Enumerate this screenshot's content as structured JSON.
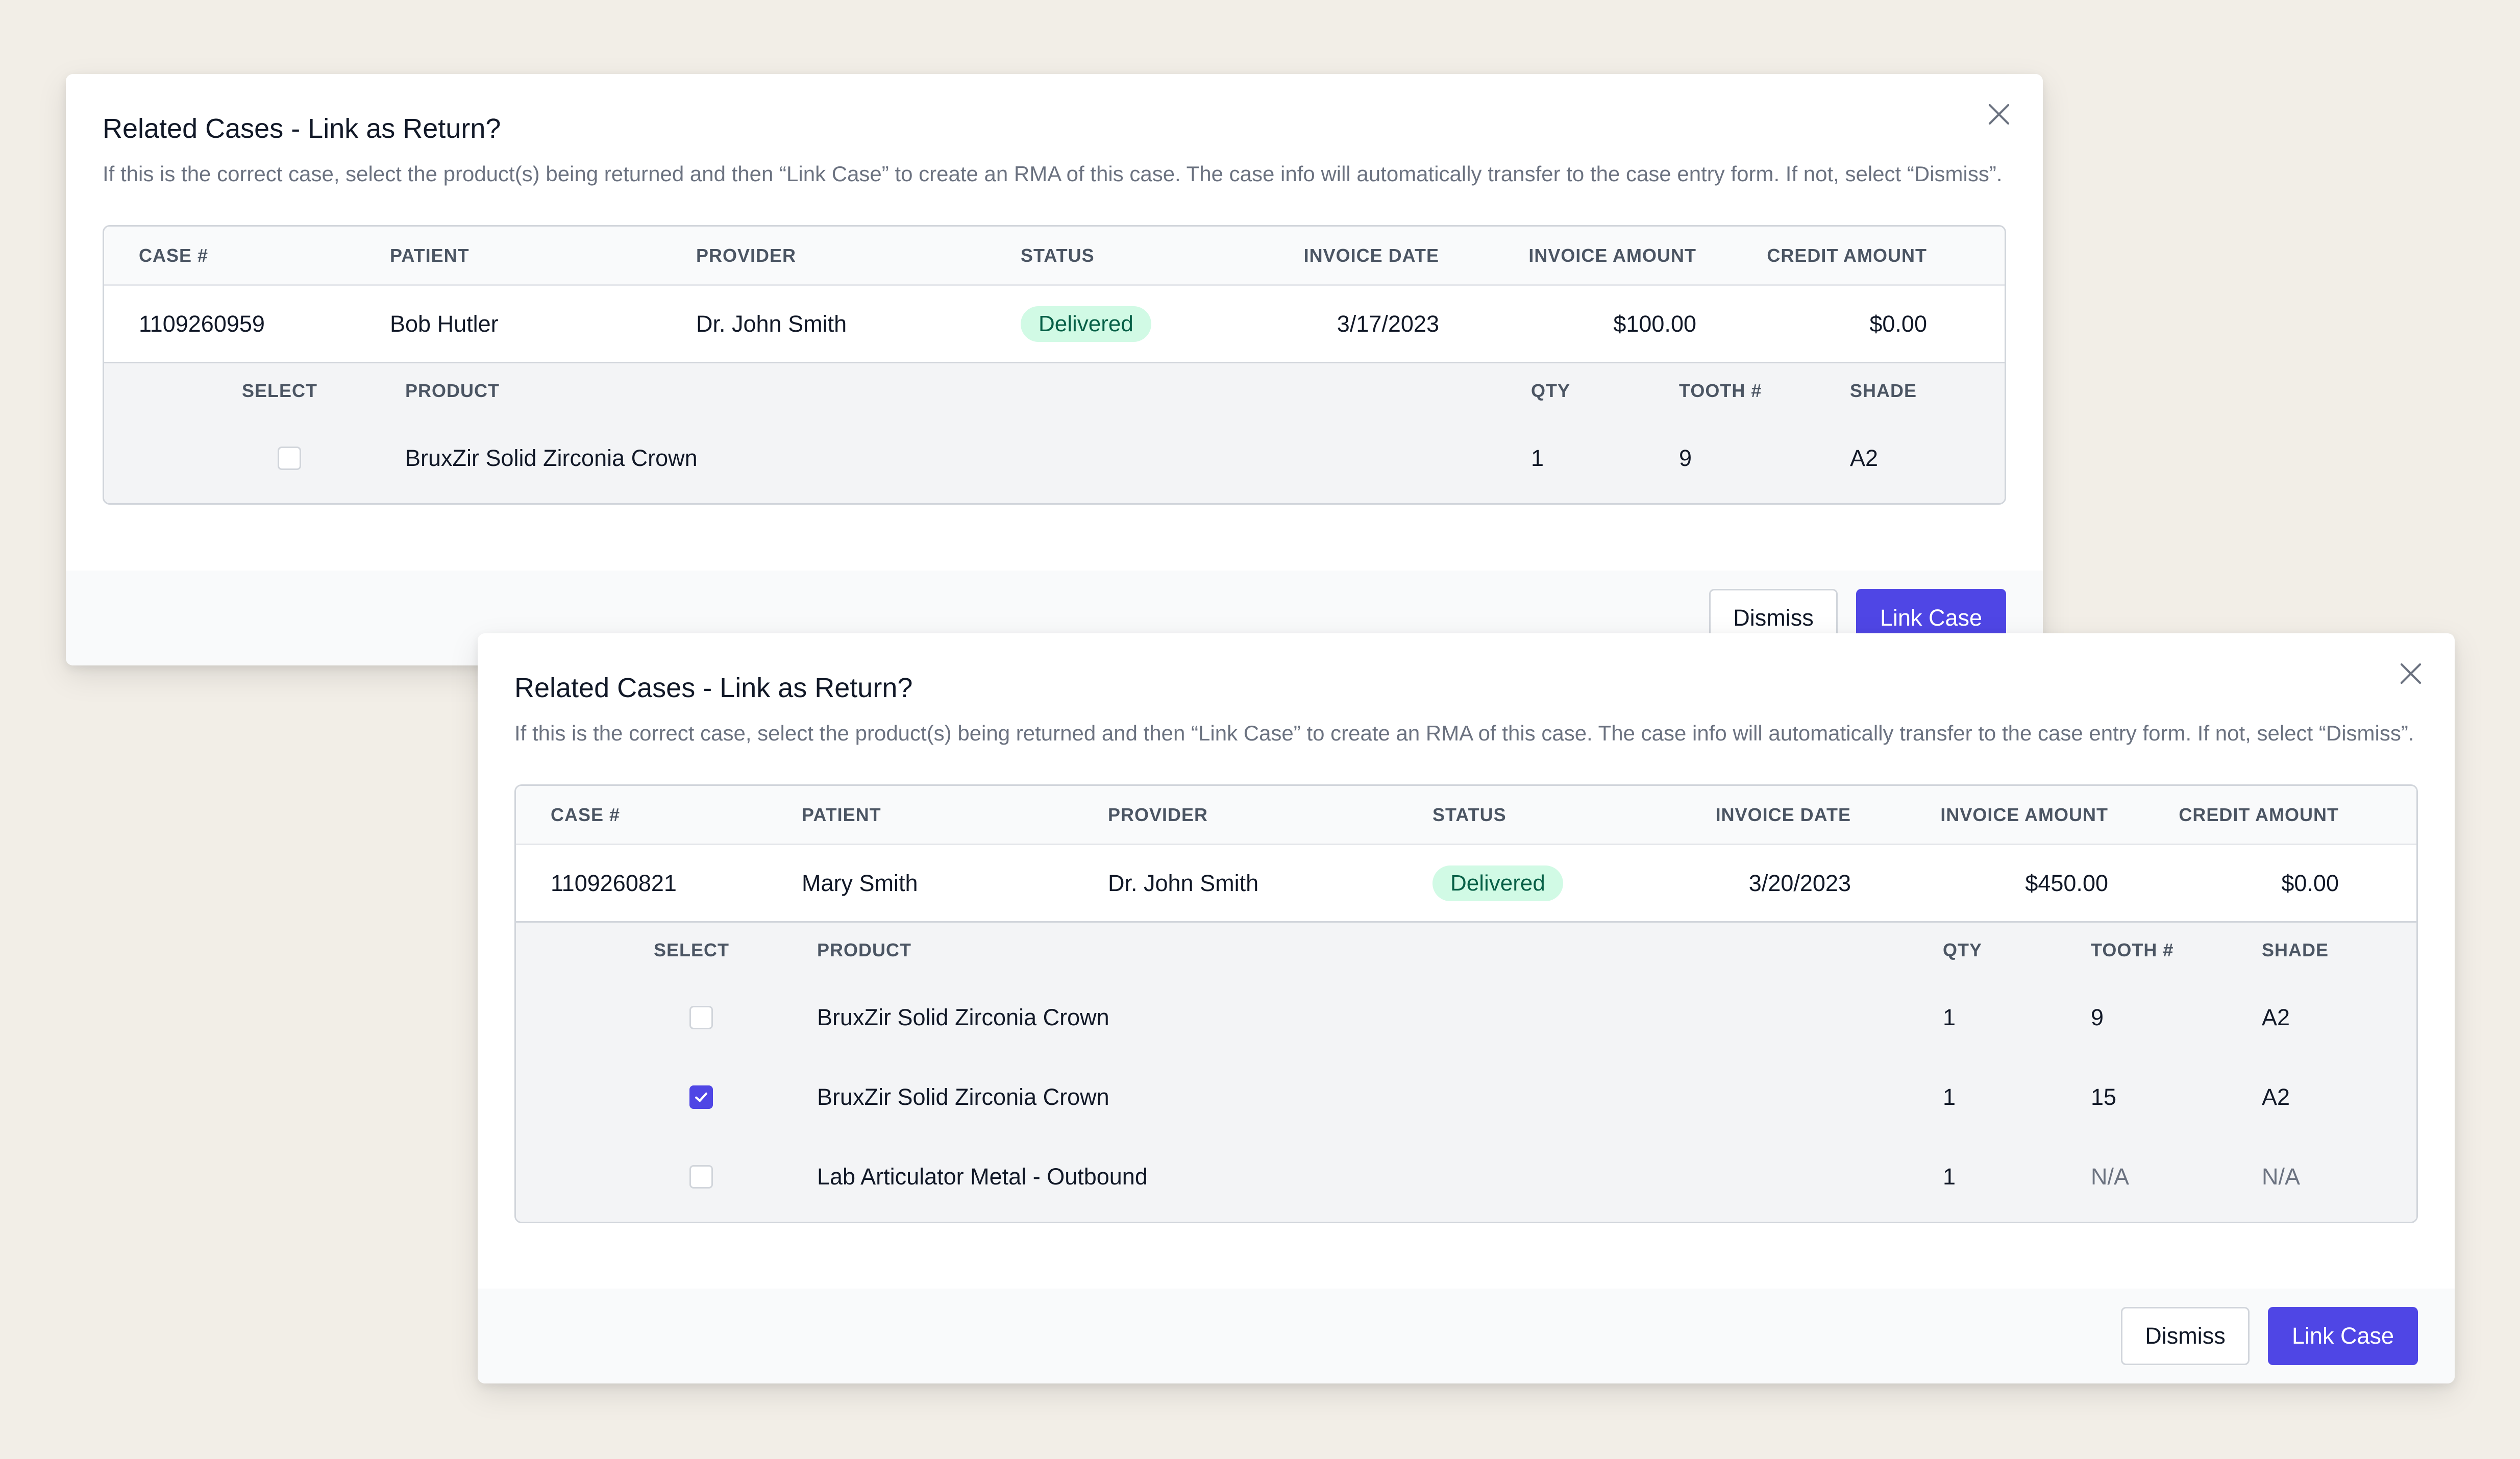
{
  "colors": {
    "background": "#f2eee7",
    "accent": "#4f46e5",
    "status_delivered_bg": "#d1fae5",
    "status_delivered_text": "#065f46"
  },
  "icons": {
    "close": "close-x-icon",
    "checkbox_checked": "check-icon"
  },
  "modals": [
    {
      "title": "Related Cases - Link as Return?",
      "description": "If this is the correct case, select the product(s) being returned and then “Link Case” to create an RMA of this case. The case info will automatically transfer to the case entry form. If not, select “Dismiss”.",
      "table_headers": [
        "CASE #",
        "PATIENT",
        "PROVIDER",
        "STATUS",
        "INVOICE DATE",
        "INVOICE AMOUNT",
        "CREDIT AMOUNT"
      ],
      "case": {
        "case_number": "1109260959",
        "patient": "Bob Hutler",
        "provider": "Dr. John Smith",
        "status": "Delivered",
        "invoice_date": "3/17/2023",
        "invoice_amount": "$100.00",
        "credit_amount": "$0.00"
      },
      "product_headers": [
        "SELECT",
        "PRODUCT",
        "QTY",
        "TOOTH #",
        "SHADE"
      ],
      "products": [
        {
          "selected": false,
          "product": "BruxZir Solid Zirconia Crown",
          "qty": "1",
          "tooth": "9",
          "shade": "A2"
        }
      ],
      "buttons": {
        "dismiss": "Dismiss",
        "link": "Link Case"
      }
    },
    {
      "title": "Related Cases - Link as Return?",
      "description": "If this is the correct case, select the product(s) being returned and then “Link Case” to create an RMA of this case. The case info will automatically transfer to the case entry form. If not, select “Dismiss”.",
      "table_headers": [
        "CASE #",
        "PATIENT",
        "PROVIDER",
        "STATUS",
        "INVOICE DATE",
        "INVOICE AMOUNT",
        "CREDIT AMOUNT"
      ],
      "case": {
        "case_number": "1109260821",
        "patient": "Mary Smith",
        "provider": "Dr. John Smith",
        "status": "Delivered",
        "invoice_date": "3/20/2023",
        "invoice_amount": "$450.00",
        "credit_amount": "$0.00"
      },
      "product_headers": [
        "SELECT",
        "PRODUCT",
        "QTY",
        "TOOTH #",
        "SHADE"
      ],
      "products": [
        {
          "selected": false,
          "product": "BruxZir Solid Zirconia Crown",
          "qty": "1",
          "tooth": "9",
          "shade": "A2"
        },
        {
          "selected": true,
          "product": "BruxZir Solid Zirconia Crown",
          "qty": "1",
          "tooth": "15",
          "shade": "A2"
        },
        {
          "selected": false,
          "product": "Lab Articulator Metal - Outbound",
          "qty": "1",
          "tooth": "N/A",
          "shade": "N/A"
        }
      ],
      "buttons": {
        "dismiss": "Dismiss",
        "link": "Link Case"
      }
    }
  ]
}
